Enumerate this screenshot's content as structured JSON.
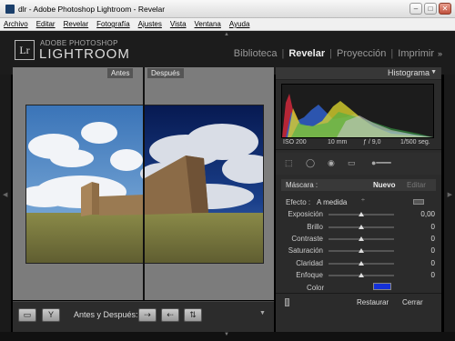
{
  "window": {
    "title": "dlr - Adobe Photoshop Lightroom - Revelar",
    "minimize": "–",
    "maximize": "□",
    "close": "✕"
  },
  "menu": [
    "Archivo",
    "Editar",
    "Revelar",
    "Fotografía",
    "Ajustes",
    "Vista",
    "Ventana",
    "Ayuda"
  ],
  "identity": {
    "badge": "Lr",
    "line1": "ADOBE PHOTOSHOP",
    "line2": "LIGHTROOM"
  },
  "modules": {
    "items": [
      "Biblioteca",
      "Revelar",
      "Proyección",
      "Imprimir"
    ],
    "active": "Revelar",
    "more": "»"
  },
  "view": {
    "before_label": "Antes",
    "after_label": "Después"
  },
  "toolbar": {
    "before_after_label": "Antes y Después:"
  },
  "histogram": {
    "title": "Histograma",
    "iso": "ISO 200",
    "focal": "10 mm",
    "aperture": "ƒ / 9,0",
    "shutter": "1/500 seg."
  },
  "mask": {
    "label": "Máscara :",
    "new": "Nuevo",
    "edit": "Editar"
  },
  "effect": {
    "label": "Efecto :",
    "value": "A medida",
    "arrows": "÷"
  },
  "sliders": [
    {
      "label": "Exposición",
      "value": "0,00",
      "pos": 0.5
    },
    {
      "label": "Brillo",
      "value": "0",
      "pos": 0.5
    },
    {
      "label": "Contraste",
      "value": "0",
      "pos": 0.5
    },
    {
      "label": "Saturación",
      "value": "0",
      "pos": 0.5
    },
    {
      "label": "Claridad",
      "value": "0",
      "pos": 0.5
    },
    {
      "label": "Enfoque",
      "value": "0",
      "pos": 0.5
    }
  ],
  "color": {
    "label": "Color",
    "swatch": "#1531d8"
  },
  "actions": {
    "reset": "Restaurar",
    "close": "Cerrar"
  },
  "colors": {
    "panel": "#2b2b2b",
    "canvas": "#7c7c7c",
    "accent": "#1531d8"
  }
}
